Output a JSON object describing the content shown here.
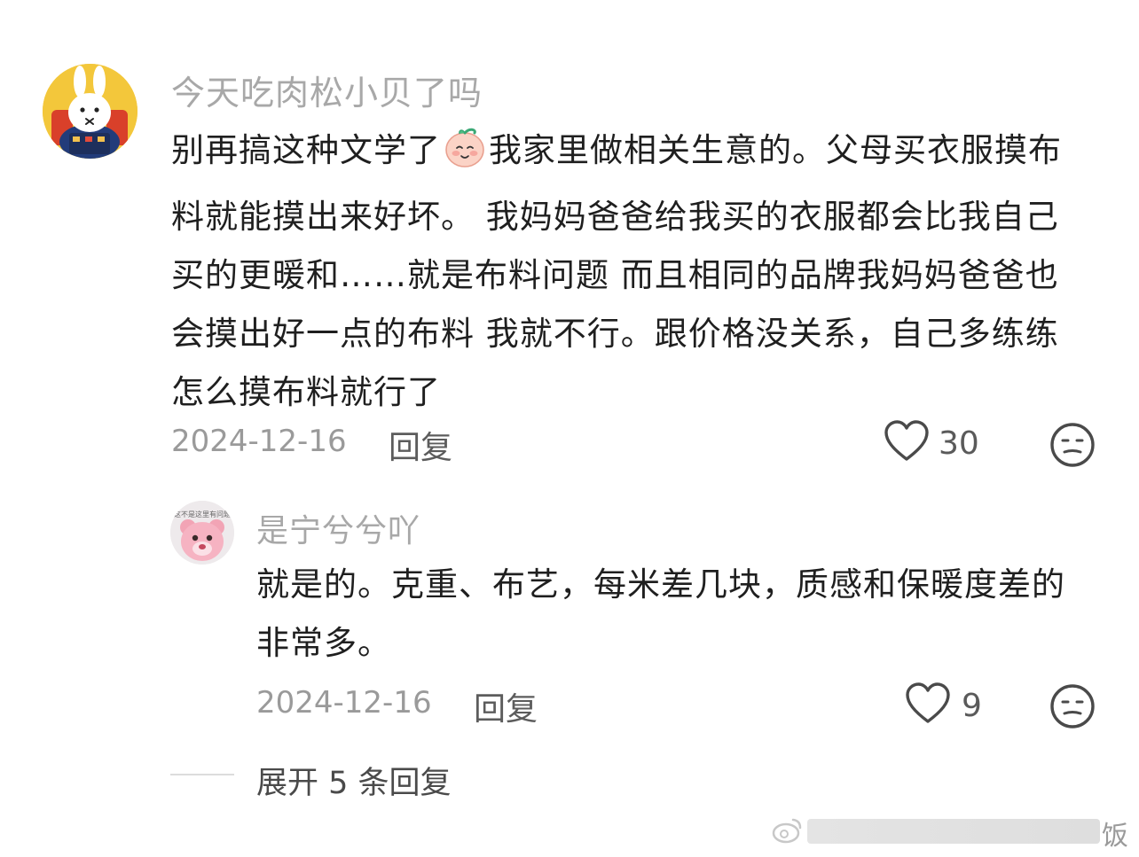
{
  "comments": [
    {
      "username": "今天吃肉松小贝了吗",
      "text_before_emoji": "别再搞这种文学了",
      "emoji": "peach-face-emoji",
      "text_after_emoji": "我家里做相关生意的。父母买衣服摸布料就能摸出来好坏。 我妈妈爸爸给我买的衣服都会比我自己买的更暖和……就是布料问题 而且相同的品牌我妈妈爸爸也会摸出好一点的布料 我就不行。跟价格没关系，自己多练练怎么摸布料就行了",
      "date": "2024-12-16",
      "reply_label": "回复",
      "likes": "30",
      "avatar_icon": "miffy-bunny-avatar",
      "avatar_color": "#f3c73b"
    },
    {
      "username": "是宁兮兮吖",
      "text": "就是的。克重、布艺，每米差几块，质感和保暖度差的非常多。",
      "date": "2024-12-16",
      "reply_label": "回复",
      "likes": "9",
      "avatar_icon": "pink-bear-avatar",
      "avatar_caption": "这不是这里有问题"
    }
  ],
  "expand": {
    "label": "展开 5 条回复"
  },
  "watermark": {
    "text": "饭"
  },
  "colors": {
    "username": "#a8a8a8",
    "body": "#1f1f1f",
    "meta": "#9a9a9a"
  }
}
